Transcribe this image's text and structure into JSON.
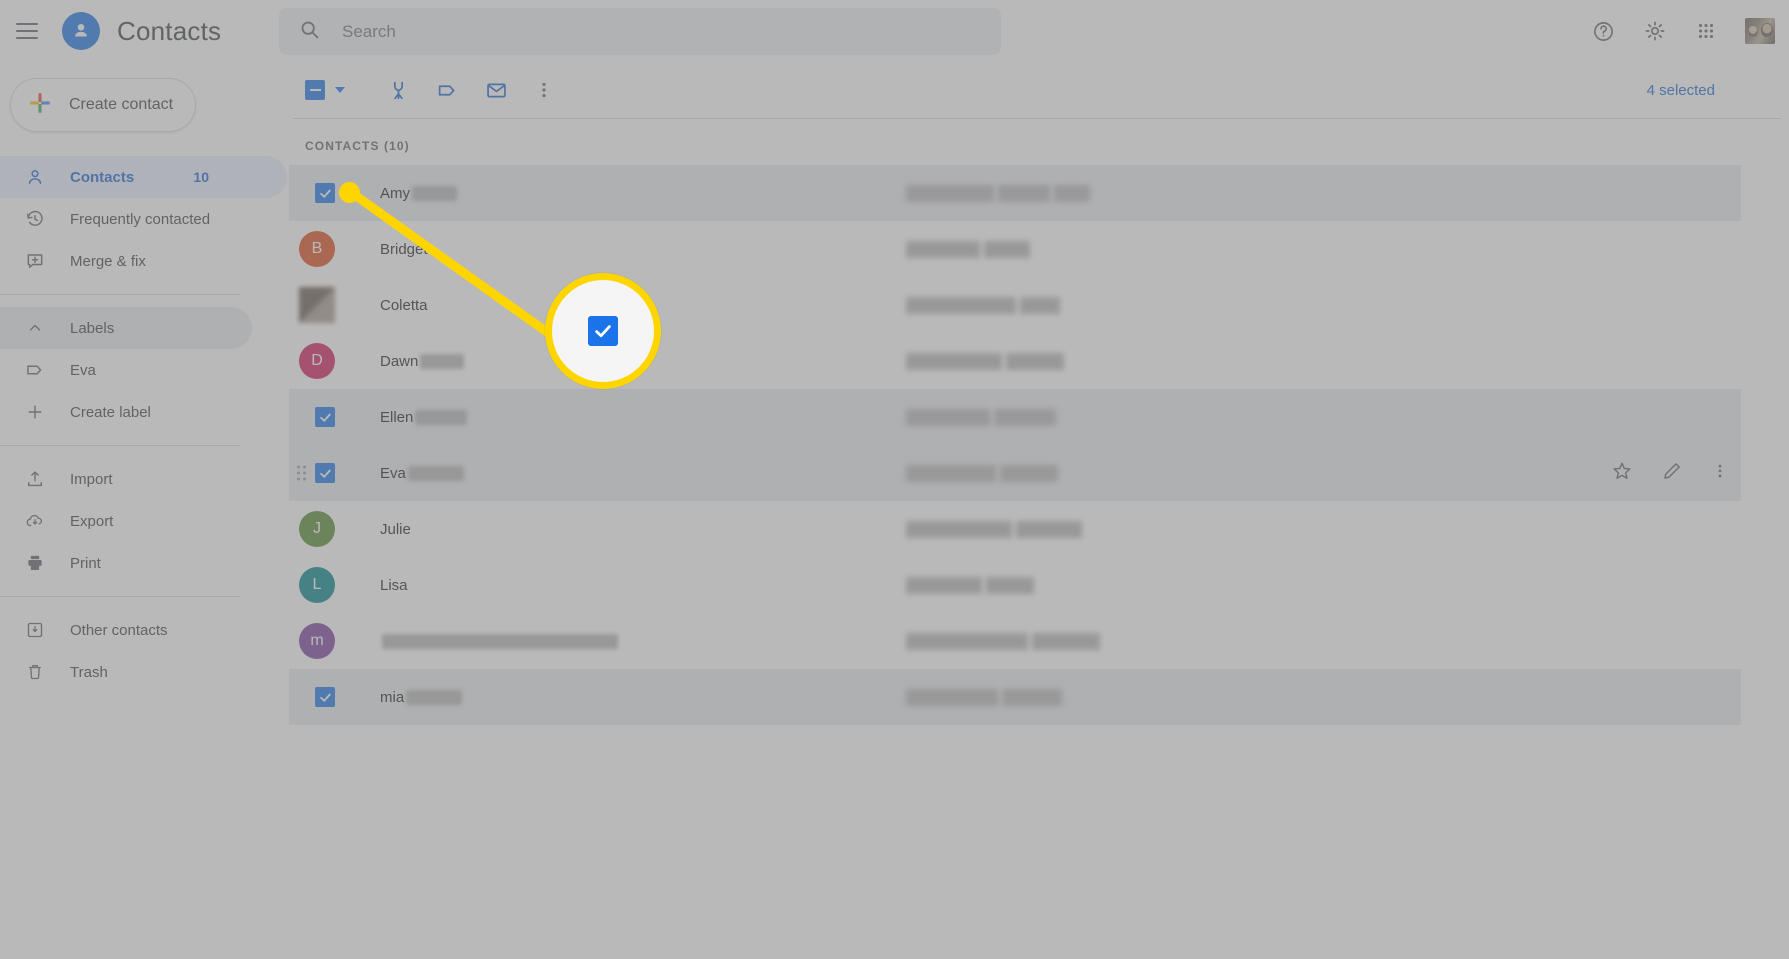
{
  "header": {
    "menu_icon": "hamburger-menu-icon",
    "logo_icon": "contacts-person-logo-icon",
    "title": "Contacts",
    "search": {
      "placeholder": "Search",
      "value": "",
      "icon": "search-icon"
    },
    "help_icon": "help-circle-icon",
    "settings_icon": "gear-icon",
    "apps_icon": "apps-grid-icon",
    "avatar": "user-avatar-photo"
  },
  "sidebar": {
    "create_contact": {
      "label": "Create contact",
      "icon": "plus-icon"
    },
    "items": [
      {
        "label": "Contacts",
        "icon": "person-icon",
        "count": "10",
        "active": true
      },
      {
        "label": "Frequently contacted",
        "icon": "history-clock-icon",
        "count": "",
        "active": false
      },
      {
        "label": "Merge & fix",
        "icon": "merge-fix-icon",
        "count": "",
        "active": false
      }
    ],
    "labels_section": [
      {
        "label": "Labels",
        "icon": "chevron-up-icon",
        "count": "",
        "active": false
      },
      {
        "label": "Eva",
        "icon": "label-tag-icon",
        "count": "",
        "active": false
      },
      {
        "label": "Create label",
        "icon": "plus-thin-icon",
        "count": "",
        "active": false
      }
    ],
    "tools": [
      {
        "label": "Import",
        "icon": "import-upload-icon",
        "count": "",
        "active": false
      },
      {
        "label": "Export",
        "icon": "export-cloud-download-icon",
        "count": "",
        "active": false
      },
      {
        "label": "Print",
        "icon": "printer-icon",
        "count": "",
        "active": false
      }
    ],
    "bottom": [
      {
        "label": "Other contacts",
        "icon": "other-contacts-icon",
        "count": "",
        "active": false
      },
      {
        "label": "Trash",
        "icon": "trash-icon",
        "count": "",
        "active": false
      }
    ]
  },
  "toolbar": {
    "select_all_checkbox": "indeterminate-checkbox",
    "select_dropdown": "chevron-down-icon",
    "merge_icon": "merge-contacts-icon",
    "label_icon": "manage-labels-icon",
    "email_icon": "send-email-icon",
    "more_icon": "more-vertical-icon",
    "selected_text": "4 selected"
  },
  "list": {
    "section_title": "CONTACTS (10)",
    "rows": [
      {
        "name": "Amy",
        "name_blur_width": 45,
        "selected": true,
        "avatar_letter": "",
        "avatar_color": "",
        "drag": false,
        "mid": [
          88,
          52,
          36
        ],
        "mid_offset": 0
      },
      {
        "name": "Bridget",
        "name_blur_width": 0,
        "selected": false,
        "avatar_letter": "B",
        "avatar_color": "#DD4A1C",
        "drag": false,
        "mid": [
          74,
          46
        ],
        "mid_offset": 0
      },
      {
        "name": "Coletta",
        "name_blur_width": 0,
        "selected": false,
        "avatar_letter": "",
        "avatar_color": "photo",
        "drag": false,
        "mid": [
          110,
          40
        ],
        "mid_offset": 0
      },
      {
        "name": "Dawn",
        "name_blur_width": 44,
        "selected": false,
        "avatar_letter": "D",
        "avatar_color": "#D01B5B",
        "drag": false,
        "mid": [
          96,
          58
        ],
        "mid_offset": 0
      },
      {
        "name": "Ellen",
        "name_blur_width": 52,
        "selected": true,
        "avatar_letter": "",
        "avatar_color": "",
        "drag": false,
        "mid": [
          84,
          62
        ],
        "mid_offset": 0
      },
      {
        "name": "Eva",
        "name_blur_width": 56,
        "selected": true,
        "avatar_letter": "",
        "avatar_color": "",
        "drag": true,
        "mid": [
          90,
          58
        ],
        "mid_offset": 0
      },
      {
        "name": "Julie",
        "name_blur_width": 0,
        "selected": false,
        "avatar_letter": "J",
        "avatar_color": "#558B2F",
        "drag": false,
        "mid": [
          106,
          66
        ],
        "mid_offset": 0
      },
      {
        "name": "Lisa",
        "name_blur_width": 0,
        "selected": false,
        "avatar_letter": "L",
        "avatar_color": "#00838F",
        "drag": false,
        "mid": [
          76,
          48
        ],
        "mid_offset": 0
      },
      {
        "name": "",
        "name_blur_width": 236,
        "selected": false,
        "avatar_letter": "m",
        "avatar_color": "#7B3FA0",
        "drag": false,
        "mid": [
          122,
          68
        ],
        "mid_offset": 0
      },
      {
        "name": "mia",
        "name_blur_width": 56,
        "selected": true,
        "avatar_letter": "",
        "avatar_color": "",
        "drag": false,
        "mid": [
          92,
          60
        ],
        "mid_offset": 0
      }
    ],
    "row_actions": {
      "star_icon": "star-outline-icon",
      "edit_icon": "pencil-edit-icon",
      "more_icon": "more-vertical-icon"
    }
  },
  "callout": {
    "magnified_element": "checked-checkbox",
    "highlight_color": "#ffd500"
  },
  "colors": {
    "accent": "#1a73e8",
    "selected_row": "#e8eaed",
    "active_nav": "#e8f0fe"
  }
}
